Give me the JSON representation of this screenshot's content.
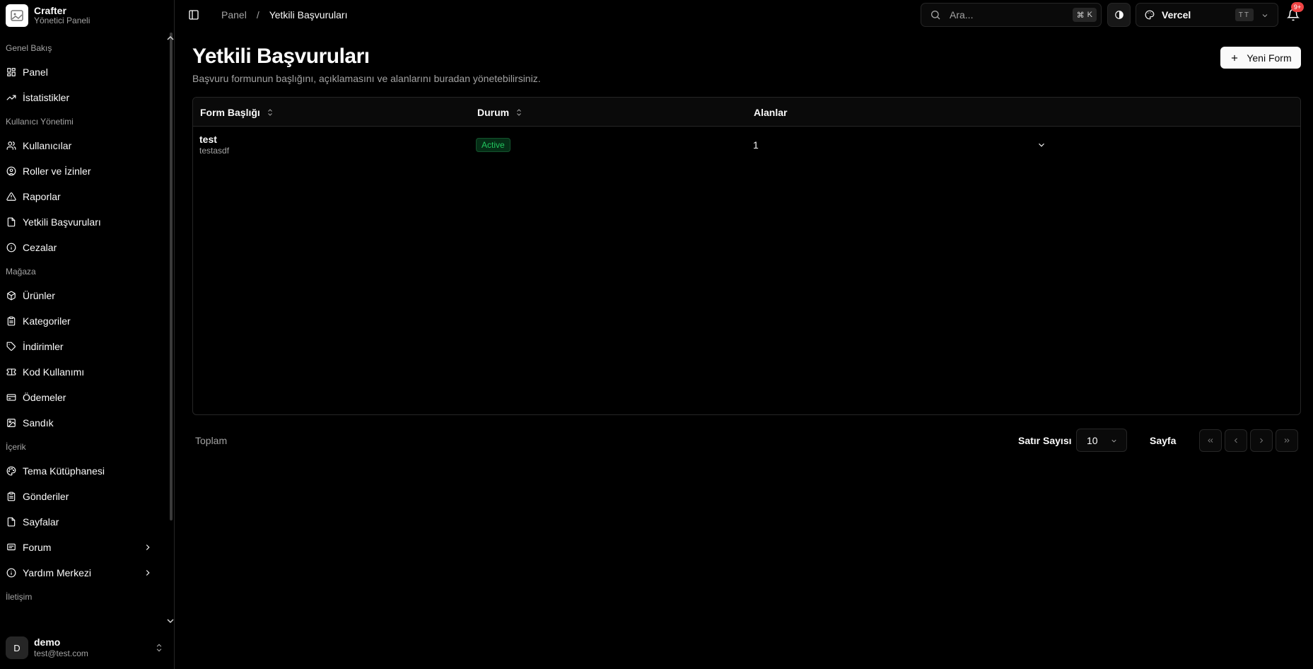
{
  "brand": {
    "name": "Crafter",
    "subtitle": "Yönetici Paneli"
  },
  "sidebar": {
    "sections": [
      {
        "title": "Genel Bakış",
        "items": [
          {
            "label": "Panel",
            "icon": "dashboard-icon"
          },
          {
            "label": "İstatistikler",
            "icon": "trending-up-icon"
          }
        ]
      },
      {
        "title": "Kullanıcı Yönetimi",
        "items": [
          {
            "label": "Kullanıcılar",
            "icon": "users-icon"
          },
          {
            "label": "Roller ve İzinler",
            "icon": "user-circle-icon"
          },
          {
            "label": "Raporlar",
            "icon": "warning-icon"
          },
          {
            "label": "Yetkili Başvuruları",
            "icon": "file-icon"
          },
          {
            "label": "Cezalar",
            "icon": "info-icon"
          }
        ]
      },
      {
        "title": "Mağaza",
        "items": [
          {
            "label": "Ürünler",
            "icon": "box-icon"
          },
          {
            "label": "Kategoriler",
            "icon": "clipboard-icon"
          },
          {
            "label": "İndirimler",
            "icon": "tag-icon"
          },
          {
            "label": "Kod Kullanımı",
            "icon": "ticket-icon"
          },
          {
            "label": "Ödemeler",
            "icon": "credit-card-icon"
          },
          {
            "label": "Sandık",
            "icon": "image-icon"
          }
        ]
      },
      {
        "title": "İçerik",
        "items": [
          {
            "label": "Tema Kütüphanesi",
            "icon": "palette-icon"
          },
          {
            "label": "Gönderiler",
            "icon": "clipboard-icon"
          },
          {
            "label": "Sayfalar",
            "icon": "file-icon"
          },
          {
            "label": "Forum",
            "icon": "message-icon",
            "expandable": true
          },
          {
            "label": "Yardım Merkezi",
            "icon": "info-icon",
            "expandable": true
          }
        ]
      },
      {
        "title": "İletişim",
        "items": []
      }
    ]
  },
  "user": {
    "initial": "D",
    "name": "demo",
    "email": "test@test.com"
  },
  "header": {
    "breadcrumb": {
      "parent": "Panel",
      "separator": "/",
      "current": "Yetkili Başvuruları"
    },
    "search": {
      "placeholder": "Ara...",
      "shortcut_symbol": "⌘",
      "shortcut_key": "K"
    },
    "team": {
      "name": "Vercel",
      "initials": "TT"
    },
    "notifications_badge": "9+"
  },
  "page": {
    "title": "Yetkili Başvuruları",
    "description": "Başvuru formunun başlığını, açıklamasını ve alanlarını buradan yönetebilirsiniz.",
    "new_button": "Yeni Form"
  },
  "table": {
    "columns": [
      "Form Başlığı",
      "Durum",
      "Alanlar"
    ],
    "rows": [
      {
        "title": "test",
        "description": "testasdf",
        "status": "Active",
        "fields": "1"
      }
    ]
  },
  "footer": {
    "total_label": "Toplam",
    "rows_label": "Satır Sayısı",
    "rows_value": "10",
    "page_label": "Sayfa"
  },
  "colors": {
    "background": "#000000",
    "border": "#262626",
    "status_active": "#22c55e",
    "badge": "#ef4444"
  }
}
